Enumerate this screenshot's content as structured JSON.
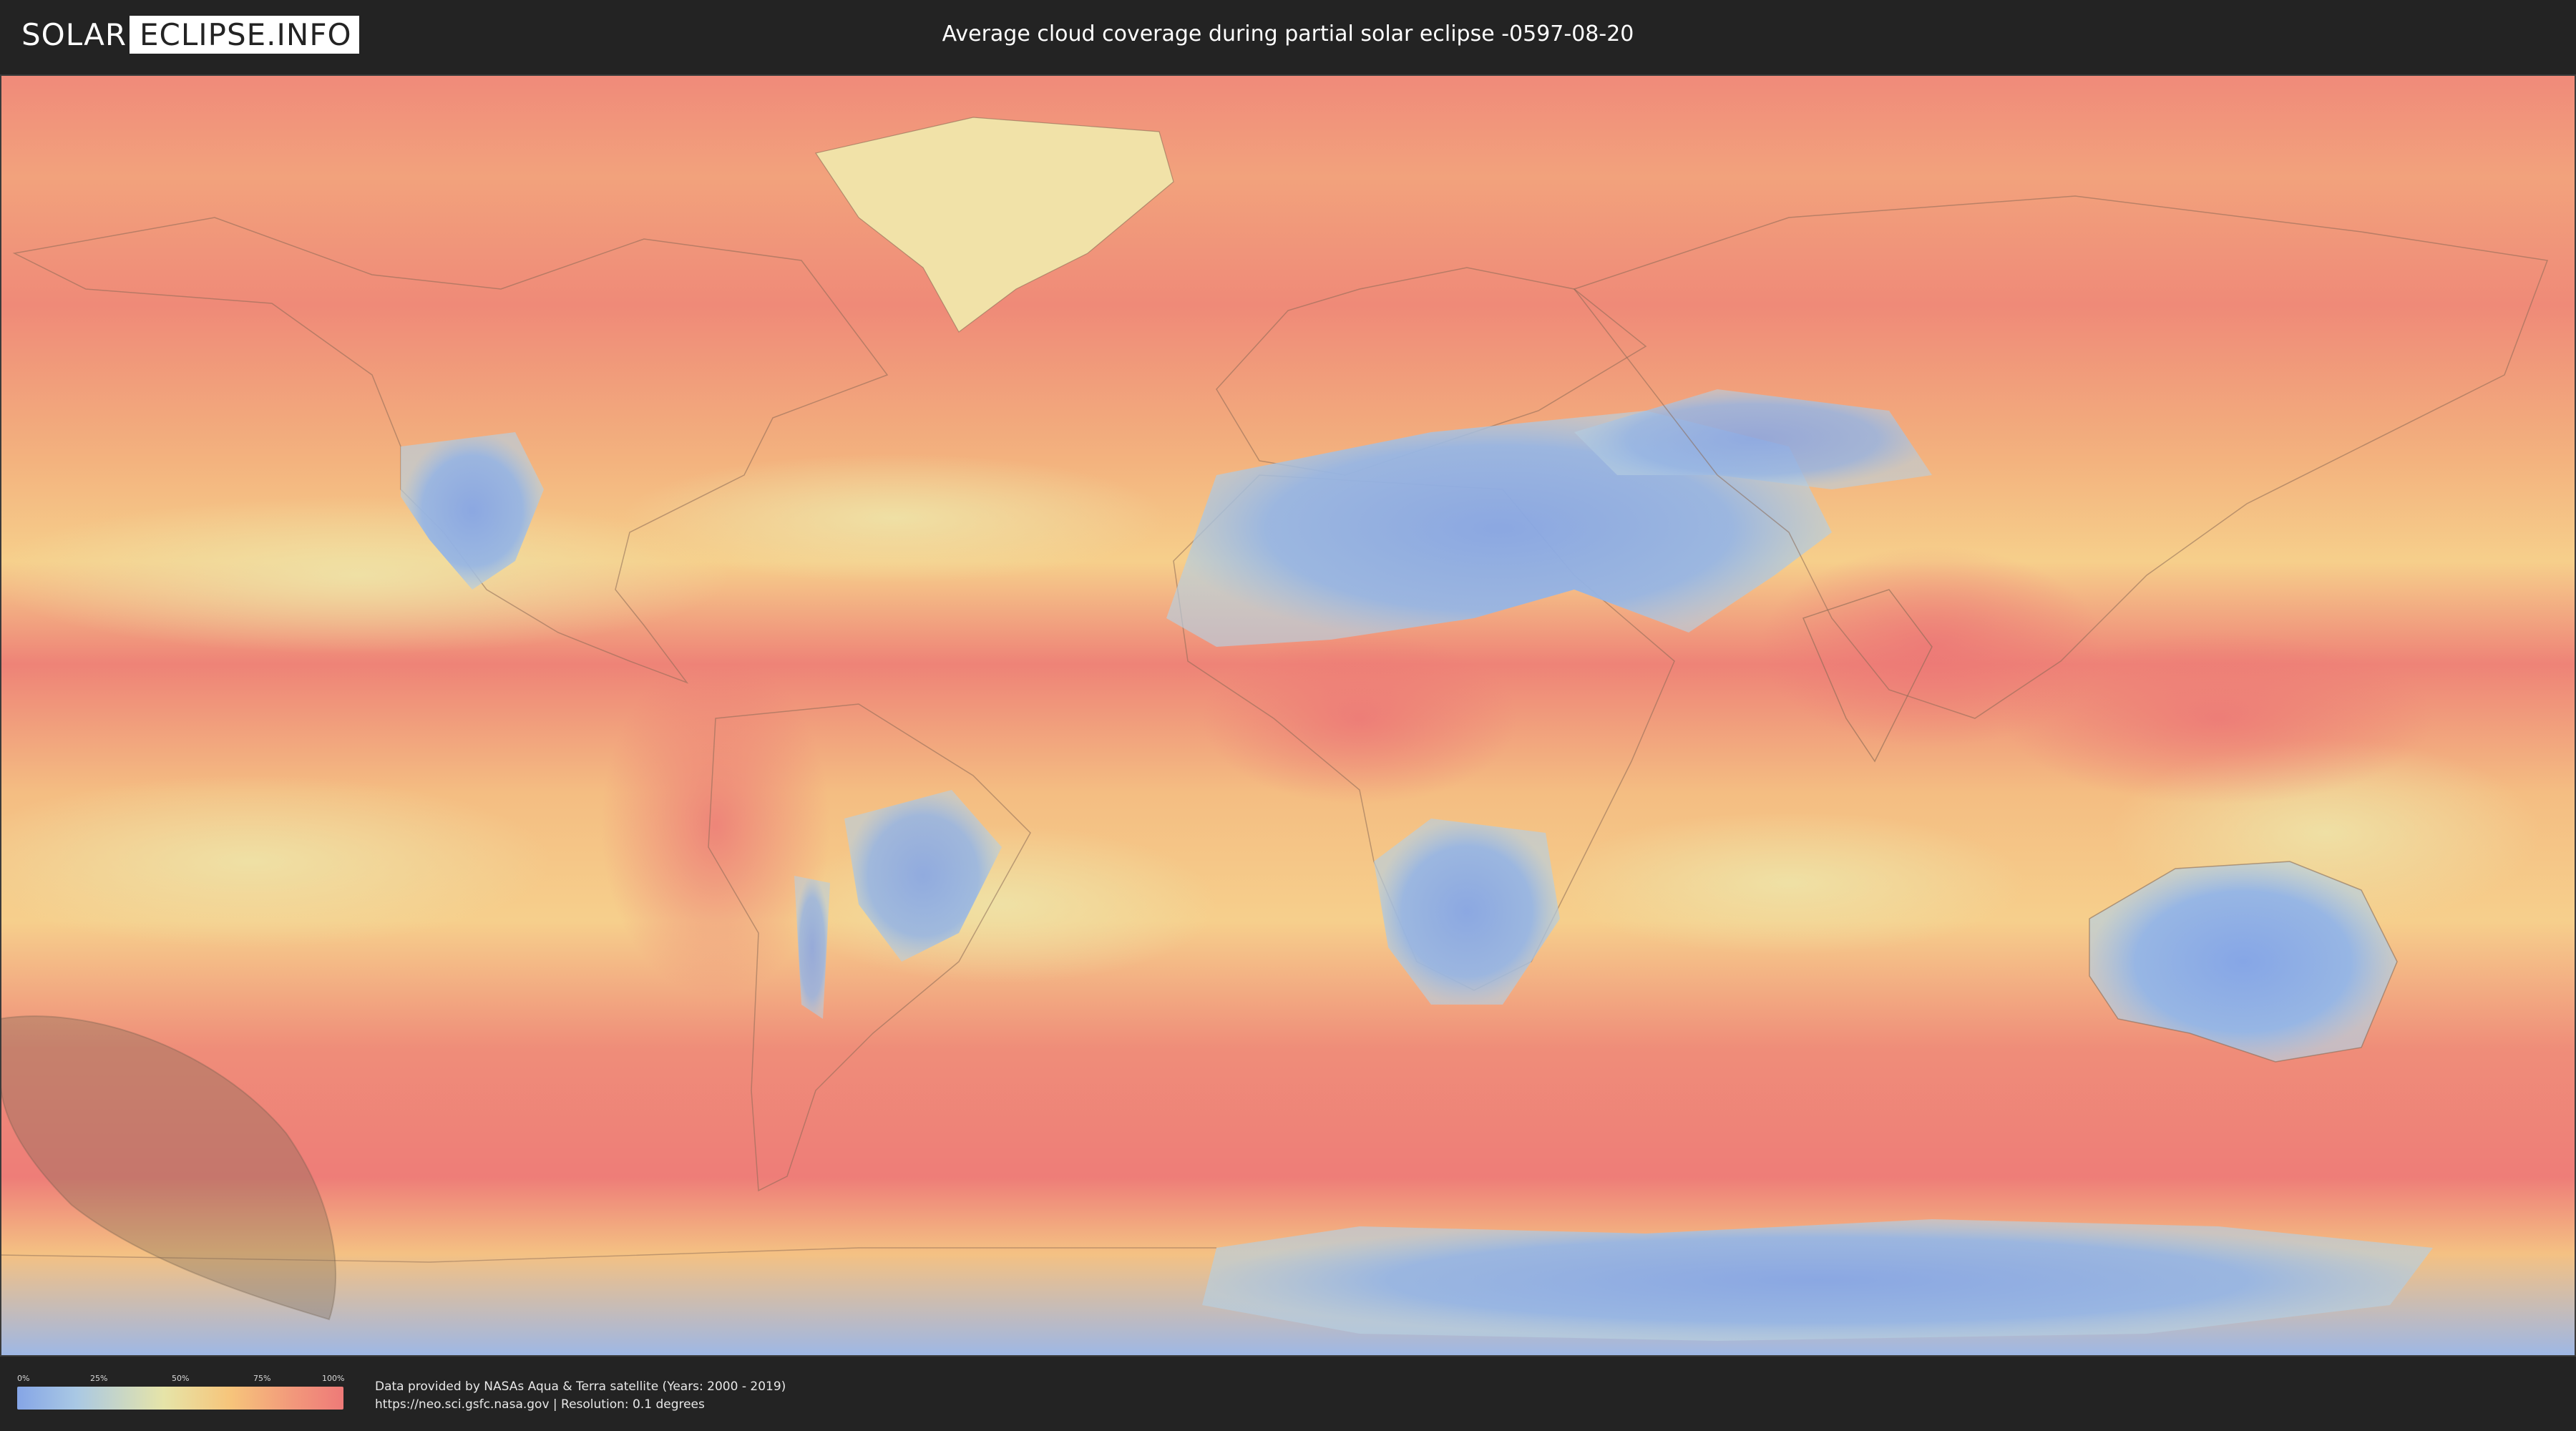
{
  "header": {
    "logo_left": "SOLAR",
    "logo_right": "ECLIPSE.INFO",
    "title": "Average cloud coverage during partial solar eclipse -0597-08-20"
  },
  "legend": {
    "ticks": [
      "0%",
      "25%",
      "50%",
      "75%",
      "100%"
    ],
    "gradient_colors": [
      "#85a5e6",
      "#a9c8e4",
      "#e6e4a8",
      "#f6c57b",
      "#f2977b",
      "#ee7a78"
    ]
  },
  "footer": {
    "credit_line_1": "Data provided by NASAs Aqua & Terra satellite (Years: 2000 - 2019)",
    "credit_line_2": "https://neo.sci.gsfc.nasa.gov | Resolution: 0.1 degrees"
  },
  "colors": {
    "background": "#232323",
    "low_cloud": "#85a5e6",
    "mid_cloud": "#f6d48c",
    "high_cloud": "#ee7a78",
    "eclipse_shadow": "#7a6a55"
  }
}
